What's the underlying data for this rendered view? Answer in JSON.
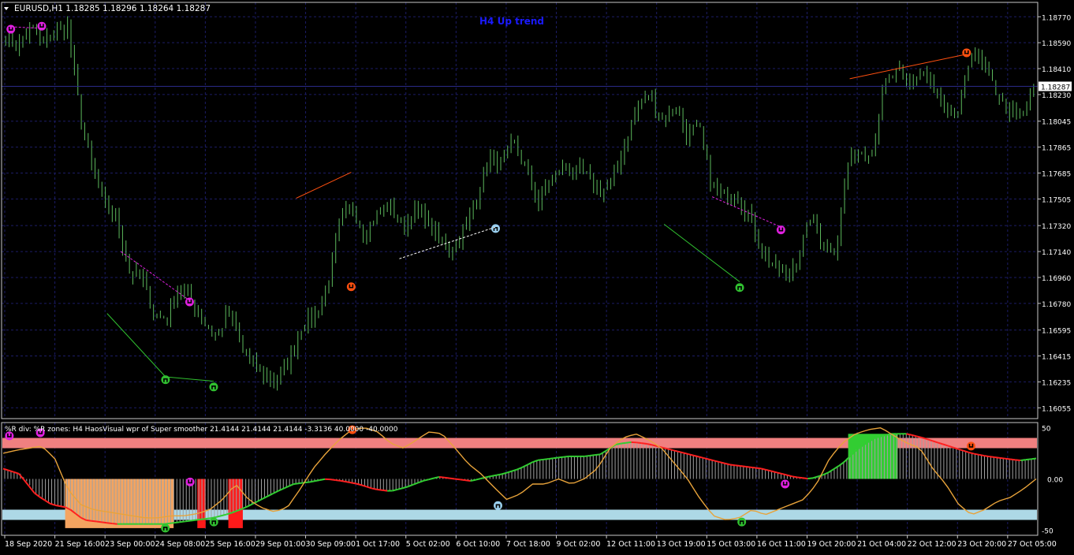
{
  "header": {
    "symbol_line": "EURUSD,H1  1.18285 1.18296 1.18264 1.18287",
    "trend_label": "H4 Up trend"
  },
  "indicator": {
    "label": "%R div: %R zones: H4 HaosVisual wpr of Super smoother 21.4144 21.4144 21.4144 -3.3136 40.0000 -40.0000"
  },
  "colors": {
    "background": "#000000",
    "grid": "#1c1c66",
    "candles": "#5cb85c",
    "current_price_box": "#ffffff",
    "upper_zone": "#f08080",
    "lower_zone": "#add8e6",
    "orange_zone": "#f4a460",
    "red_bars": "#ff1a1a",
    "green_block": "#32cd32",
    "wpr_line": "#e8a33a",
    "smoother_green": "#32cd32",
    "smoother_red": "#ff2020",
    "histogram": "#a0a0a0",
    "arrow_magenta": "#e020e0",
    "arrow_orange": "#ff5010",
    "arrow_green": "#30c030",
    "arrow_lightblue": "#9ad0f0"
  },
  "chart_data": [
    {
      "type": "line",
      "title": "EURUSD,H1",
      "current_price": "1.18287",
      "y_ticks": [
        "1.18770",
        "1.18590",
        "1.18410",
        "1.18230",
        "1.18045",
        "1.17865",
        "1.17685",
        "1.17505",
        "1.17320",
        "1.17140",
        "1.16960",
        "1.16780",
        "1.16595",
        "1.16415",
        "1.16235",
        "1.16055"
      ],
      "ylim": [
        1.1598,
        1.1887
      ],
      "x_ticks": [
        "18 Sep 2020",
        "21 Sep 16:00",
        "23 Sep 00:00",
        "24 Sep 08:00",
        "25 Sep 16:00",
        "29 Sep 01:00",
        "30 Sep 09:00",
        "1 Oct 17:00",
        "5 Oct 02:00",
        "6 Oct 10:00",
        "7 Oct 18:00",
        "9 Oct 02:00",
        "12 Oct 11:00",
        "13 Oct 19:00",
        "15 Oct 03:00",
        "16 Oct 11:00",
        "19 Oct 20:00",
        "21 Oct 04:00",
        "22 Oct 12:00",
        "23 Oct 20:00",
        "27 Oct 05:00"
      ],
      "close_path": [
        1.1863,
        1.1856,
        1.187,
        1.1858,
        1.1866,
        1.187,
        1.181,
        1.177,
        1.1745,
        1.1735,
        1.17,
        1.1695,
        1.167,
        1.1668,
        1.169,
        1.168,
        1.1665,
        1.1655,
        1.1672,
        1.1648,
        1.1635,
        1.1628,
        1.1624,
        1.164,
        1.1665,
        1.167,
        1.169,
        1.1735,
        1.1745,
        1.1725,
        1.174,
        1.1748,
        1.173,
        1.1742,
        1.1735,
        1.1722,
        1.1715,
        1.1728,
        1.175,
        1.1778,
        1.1775,
        1.179,
        1.1772,
        1.1748,
        1.1765,
        1.1772,
        1.177,
        1.1765,
        1.1755,
        1.1762,
        1.179,
        1.1815,
        1.1822,
        1.1805,
        1.1815,
        1.1795,
        1.18,
        1.176,
        1.1752,
        1.1755,
        1.174,
        1.1715,
        1.1705,
        1.1695,
        1.1712,
        1.1738,
        1.172,
        1.1715,
        1.1775,
        1.1785,
        1.1785,
        1.183,
        1.1838,
        1.183,
        1.184,
        1.1825,
        1.1808,
        1.1812,
        1.1855,
        1.184,
        1.1825,
        1.181,
        1.1808,
        1.1826
      ],
      "candle_count": 300,
      "annotations": {
        "bearish_arrows": 6,
        "bullish_arrows": 6
      }
    },
    {
      "type": "line",
      "title": "%R div: %R zones",
      "y_ticks": [
        "50",
        "0.00",
        "-50"
      ],
      "current_value": "0.00",
      "ylim": [
        -55,
        55
      ],
      "zones": {
        "upper": [
          40,
          30
        ],
        "lower": [
          -30,
          -40
        ]
      },
      "wpr": [
        25,
        28,
        30,
        32,
        20,
        -10,
        -25,
        -30,
        -32,
        -34,
        -36,
        -38,
        -38,
        -36,
        -36,
        -34,
        -30,
        -20,
        -5,
        -20,
        -28,
        -32,
        -28,
        -10,
        10,
        25,
        38,
        48,
        50,
        46,
        35,
        30,
        38,
        46,
        44,
        30,
        15,
        5,
        -8,
        -20,
        -15,
        -5,
        -5,
        0,
        -5,
        0,
        10,
        30,
        40,
        44,
        38,
        30,
        15,
        0,
        -20,
        -36,
        -40,
        -38,
        -30,
        -35,
        -30,
        -25,
        -20,
        -5,
        20,
        35,
        44,
        48,
        50,
        42,
        35,
        30,
        10,
        -5,
        -25,
        -35,
        -30,
        -22,
        -18,
        -10,
        0
      ],
      "smoother": [
        10,
        5,
        -15,
        -25,
        -28,
        -40,
        -42,
        -44,
        -44,
        -44,
        -44,
        -42,
        -40,
        -38,
        -34,
        -28,
        -20,
        -12,
        -5,
        -3,
        0,
        -2,
        -5,
        -10,
        -12,
        -8,
        -2,
        2,
        0,
        -2,
        2,
        5,
        10,
        18,
        20,
        22,
        22,
        24,
        34,
        36,
        34,
        30,
        26,
        22,
        18,
        14,
        12,
        10,
        6,
        2,
        0,
        5,
        15,
        30,
        40,
        44,
        44,
        40,
        35,
        30,
        25,
        22,
        20,
        18,
        20
      ],
      "histogram_sign": "mirrors smoother"
    }
  ]
}
